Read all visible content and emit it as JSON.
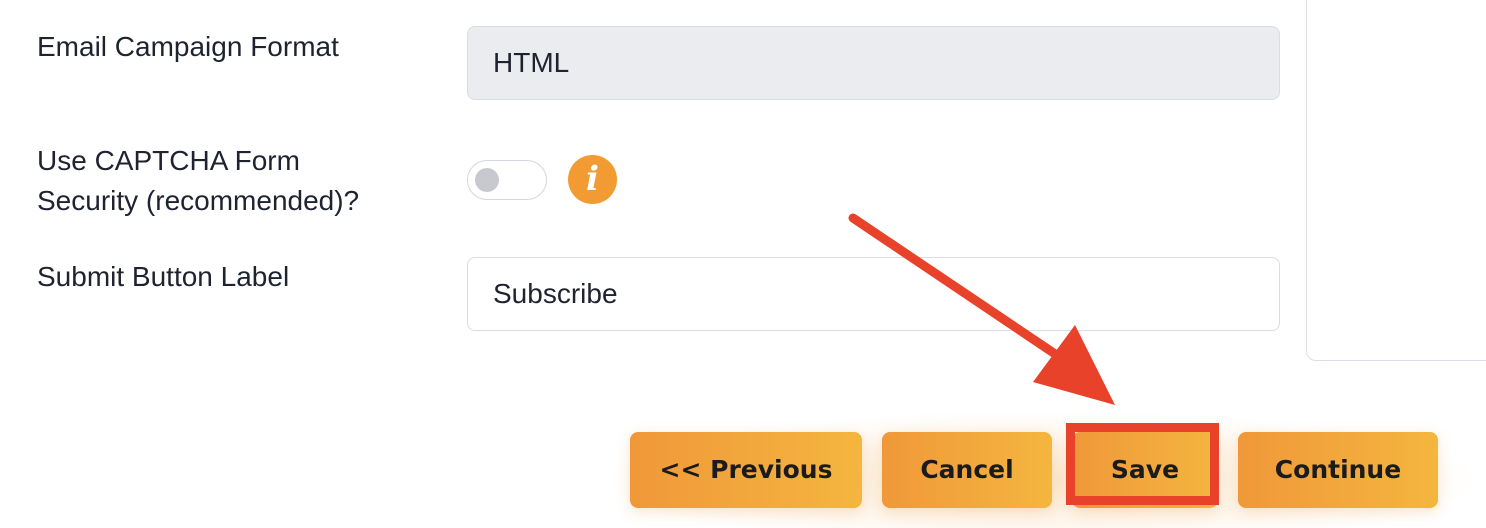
{
  "form": {
    "email_format": {
      "label": "Email Campaign Format",
      "value": "HTML"
    },
    "captcha": {
      "label_line1": "Use CAPTCHA Form",
      "label_line2": "Security (recommended)?",
      "enabled": false,
      "info_glyph": "i"
    },
    "submit_label": {
      "label": "Submit Button Label",
      "value": "Subscribe"
    }
  },
  "actions": {
    "previous_label": "<< Previous",
    "cancel_label": "Cancel",
    "save_label": "Save",
    "continue_label": "Continue"
  },
  "annotation": {
    "color": "#e8422a",
    "target": "save-button"
  },
  "colors": {
    "button_gradient_start": "#f0983a",
    "button_gradient_end": "#f4b63e",
    "info_icon": "#f29b33"
  },
  "icons": {
    "info": "info-icon",
    "toggle": "toggle-switch"
  }
}
